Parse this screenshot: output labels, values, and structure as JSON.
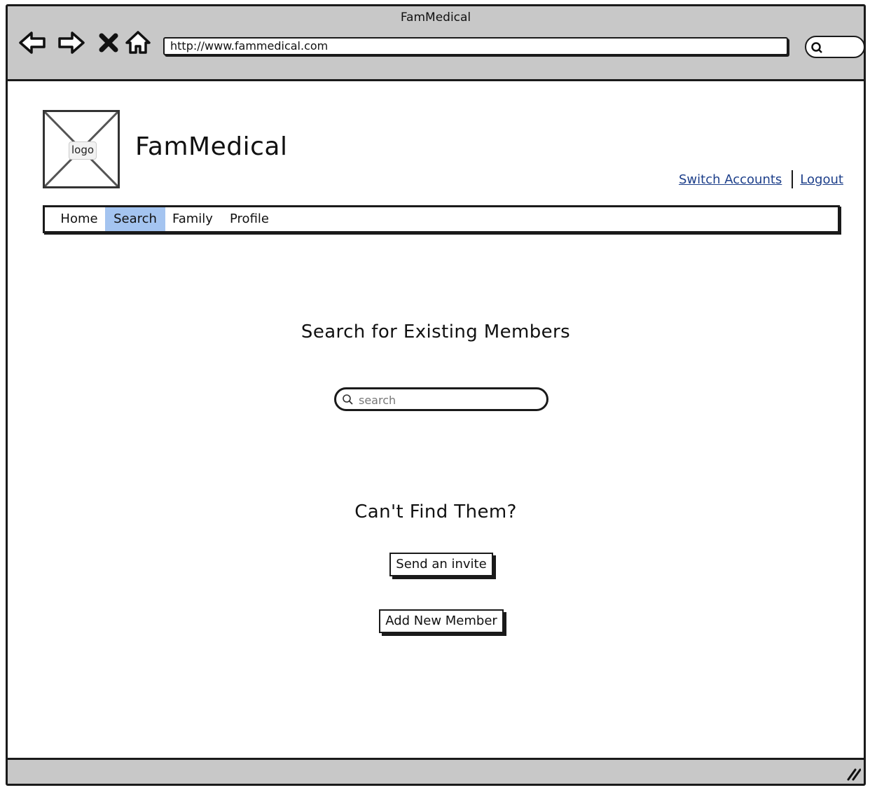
{
  "window": {
    "title": "FamMedical"
  },
  "browser": {
    "url": "http://www.fammedical.com",
    "nav": [
      "back-icon",
      "forward-icon",
      "stop-icon",
      "home-icon"
    ],
    "search_icon": "search-icon"
  },
  "header": {
    "logo_label": "logo",
    "brand": "FamMedical",
    "links": {
      "switch_accounts": "Switch Accounts",
      "logout": "Logout"
    }
  },
  "menu": {
    "items": [
      "Home",
      "Search",
      "Family",
      "Profile"
    ],
    "active": "Search",
    "active_color": "#a4c4f0"
  },
  "main": {
    "search_title": "Search for Existing Members",
    "search_placeholder": "search",
    "not_found_title": "Can't Find Them?",
    "send_invite_label": "Send an invite",
    "add_member_label": "Add New Member"
  }
}
